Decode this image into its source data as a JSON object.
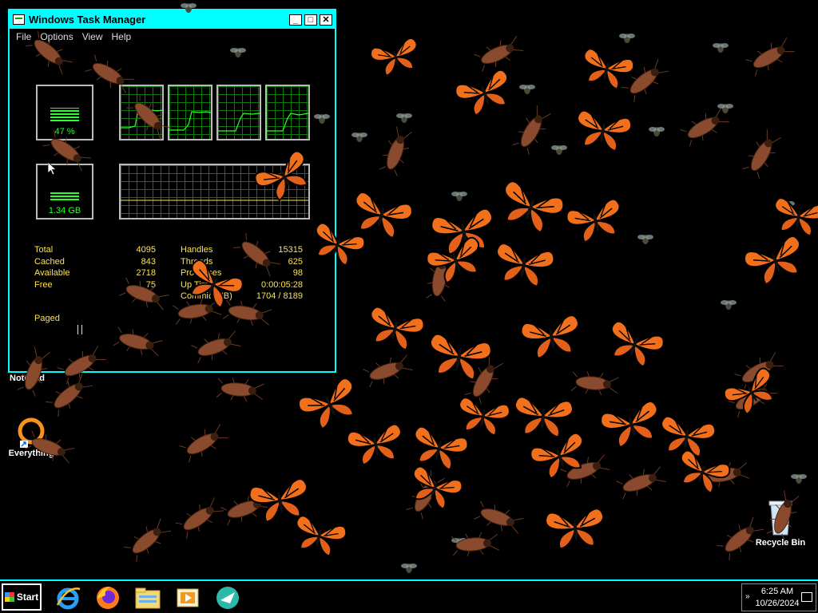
{
  "taskmgr": {
    "title": "Windows Task Manager",
    "menu": [
      "File",
      "Options",
      "View",
      "Help"
    ],
    "cpu_usage": "47 %",
    "cpu_fraction": 0.47,
    "mem_usage": "1.34 GB",
    "mem_fraction": 0.35,
    "physical": {
      "total_label": "Total",
      "total": "4095",
      "cached_label": "Cached",
      "cached": "843",
      "available_label": "Available",
      "available": "2718",
      "free_label": "Free",
      "free": "75"
    },
    "system": {
      "handles_label": "Handles",
      "handles": "15315",
      "threads_label": "Threads",
      "threads": "625",
      "processes_label": "Processes",
      "processes": "98",
      "uptime_label": "Up Time",
      "uptime": "0:00:05:28",
      "commit_label": "Commit (MB)",
      "commit": "1704 / 8189"
    },
    "kernel": {
      "paged_label": "Paged"
    }
  },
  "desktop": {
    "icons": {
      "notepad": "Notepad",
      "everything": "Everything",
      "recycle_bin": "Recycle Bin"
    }
  },
  "taskbar": {
    "start_label": "Start",
    "apps": [
      "internet-explorer-icon",
      "firefox-icon",
      "file-explorer-icon",
      "media-player-icon",
      "browser-icon"
    ],
    "time": "6:25 AM",
    "date": "10/26/2024"
  },
  "colors": {
    "window_border": "#00ffff",
    "meter_green": "#2aff2a",
    "stat_text": "#ffe34a",
    "butterfly": "#f2701c",
    "roach": "#8a4a2e"
  }
}
